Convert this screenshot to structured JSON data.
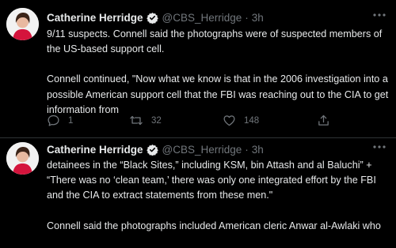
{
  "tweets": [
    {
      "author_name": "Catherine Herridge",
      "handle": "@CBS_Herridge",
      "separator": "·",
      "time": "3h",
      "paragraphs": [
        "9/11 suspects.  Connell said the photographs were of suspected members of the US-based support cell.",
        "Connell continued,  \"Now what we know is that in the 2006 investigation into a possible American support cell that the FBI was reaching out to the CIA to get information from"
      ],
      "replies": "1",
      "retweets": "32",
      "likes": "148"
    },
    {
      "author_name": "Catherine Herridge",
      "handle": "@CBS_Herridge",
      "separator": "·",
      "time": "3h",
      "paragraphs": [
        "detainees in the “Black Sites,” including KSM, bin Attash and al Baluchi” + “There was no ‘clean team,’ there was only one integrated effort by the FBI and the CIA to extract statements from these men.\"",
        "Connell said the photographs included American cleric Anwar al-Awlaki who"
      ]
    }
  ],
  "icons": {
    "reply": "reply-icon",
    "retweet": "retweet-icon",
    "like": "heart-icon",
    "share": "share-icon",
    "verified": "verified-badge-icon",
    "more": "more-options-icon"
  },
  "colors": {
    "background": "#000000",
    "text": "#e7e9ea",
    "muted": "#71767b",
    "divider": "#2f3336",
    "verified_badge": "#e7e9ea"
  }
}
